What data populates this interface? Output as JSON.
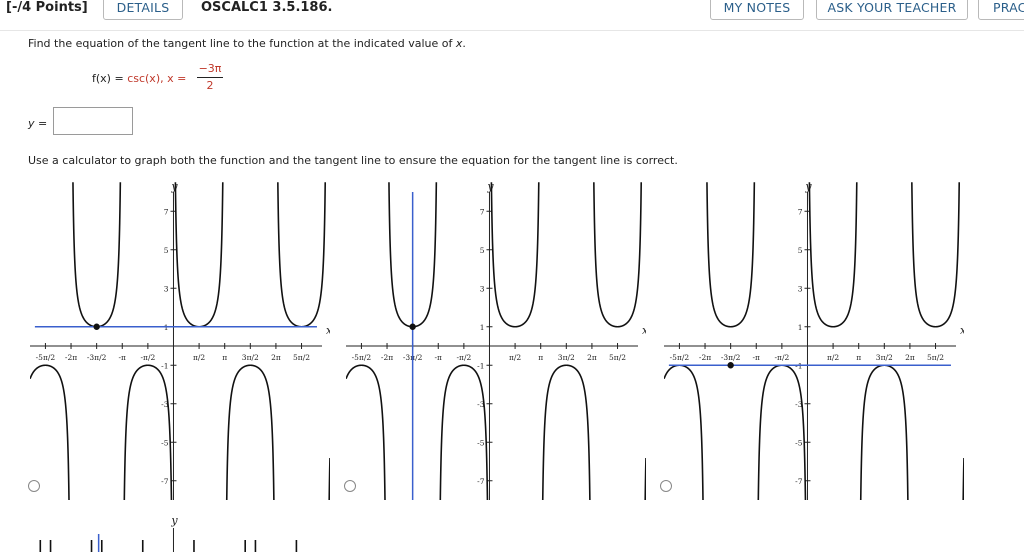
{
  "header": {
    "points": "[-/4 Points]",
    "details_label": "DETAILS",
    "code": "OSCALC1 3.5.186.",
    "my_notes_label": "MY NOTES",
    "ask_teacher_label": "ASK YOUR TEACHER",
    "practice_label": "PRAC"
  },
  "question": {
    "prompt_start": "Find the equation of the tangent line to the function at the indicated value of ",
    "prompt_var": "x",
    "prompt_end": ".",
    "function_lhs": "f(x) = ",
    "function_rhs": "csc(x), x = ",
    "x_value_numerator": "−3π",
    "x_value_denominator": "2",
    "answer_label": "y =",
    "answer_value": "",
    "instruction": "Use a calculator to graph both the function and the tangent line to ensure the equation for the tangent line is correct."
  },
  "colors": {
    "curve": "#111111",
    "tangent": "#3a5fcd",
    "link": "#2b5f8a"
  },
  "chart_data": [
    {
      "type": "line",
      "axis_x_label": "x",
      "axis_y_label": "y",
      "x_ticks": [
        "-5π/2",
        "-2π",
        "-3π/2",
        "-π",
        "-π/2",
        "π/2",
        "π",
        "3π/2",
        "2π",
        "5π/2"
      ],
      "y_ticks": [
        "-7",
        "-5",
        "-3",
        "-1",
        "1",
        "3",
        "5",
        "7"
      ],
      "series": [
        {
          "values": "csc(x)"
        },
        {
          "values": "y = 1"
        }
      ],
      "point": [
        -4.712,
        1
      ],
      "xlim": [
        -8.8,
        9.6
      ],
      "ylim": [
        -8,
        8
      ],
      "option": "A"
    },
    {
      "type": "line",
      "axis_x_label": "x",
      "axis_y_label": "y",
      "x_ticks": [
        "-5π/2",
        "-2π",
        "-3π/2",
        "-π",
        "-π/2",
        "π/2",
        "π",
        "3π/2",
        "2π",
        "5π/2"
      ],
      "y_ticks": [
        "-7",
        "-5",
        "-3",
        "-1",
        "1",
        "3",
        "5",
        "7"
      ],
      "series": [
        {
          "values": "csc(x)"
        },
        {
          "values": "x = -3π/2"
        }
      ],
      "point": [
        -4.712,
        1
      ],
      "xlim": [
        -8.8,
        9.6
      ],
      "ylim": [
        -8,
        8
      ],
      "option": "B"
    },
    {
      "type": "line",
      "axis_x_label": "x",
      "axis_y_label": "y",
      "x_ticks": [
        "-5π/2",
        "-2π",
        "-3π/2",
        "-π",
        "-π/2",
        "π/2",
        "π",
        "3π/2",
        "2π",
        "5π/2"
      ],
      "y_ticks": [
        "-7",
        "-5",
        "-3",
        "-1",
        "1",
        "3",
        "5",
        "7"
      ],
      "series": [
        {
          "values": "csc(x)"
        },
        {
          "values": "y = -1"
        }
      ],
      "point": [
        -4.712,
        -1
      ],
      "xlim": [
        -8.8,
        9.6
      ],
      "ylim": [
        -8,
        8
      ],
      "option": "C"
    }
  ]
}
